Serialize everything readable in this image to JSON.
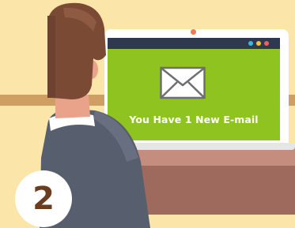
{
  "scene": {
    "background_color": "#fbe5a8",
    "screen_color": "#8fc31f",
    "window_bar_color": "#2e3950",
    "window_buttons": [
      {
        "color": "#3bb8ea"
      },
      {
        "color": "#f4c432"
      },
      {
        "color": "#f0605a"
      }
    ],
    "icon": "envelope-icon"
  },
  "screen": {
    "notification_text": "You Have 1 New E-mail"
  },
  "step": {
    "number": "2"
  }
}
